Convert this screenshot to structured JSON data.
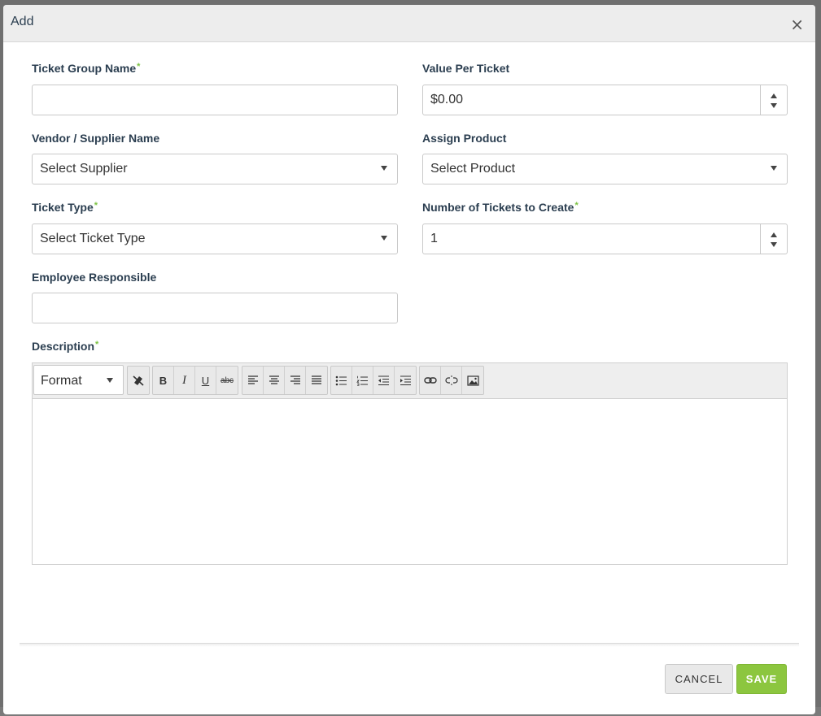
{
  "modal": {
    "title": "Add",
    "close_symbol": "×"
  },
  "fields": {
    "ticket_group_name": {
      "label": "Ticket Group Name",
      "required": "*",
      "value": ""
    },
    "value_per_ticket": {
      "label": "Value Per Ticket",
      "value": "$0.00"
    },
    "vendor_supplier": {
      "label": "Vendor / Supplier Name",
      "selected": "Select Supplier"
    },
    "assign_product": {
      "label": "Assign Product",
      "selected": "Select Product"
    },
    "ticket_type": {
      "label": "Ticket Type",
      "required": "*",
      "selected": "Select Ticket Type"
    },
    "number_of_tickets": {
      "label": "Number of Tickets to Create",
      "required": "*",
      "value": "1"
    },
    "employee_responsible": {
      "label": "Employee Responsible",
      "value": ""
    },
    "description": {
      "label": "Description",
      "required": "*"
    }
  },
  "editor": {
    "format_label": "Format",
    "buttons": {
      "bold": "B",
      "italic": "I",
      "underline": "U",
      "strikethrough": "abc"
    },
    "icons": [
      "remove-format-icon",
      "bold-icon",
      "italic-icon",
      "underline-icon",
      "strikethrough-icon",
      "align-left-icon",
      "align-center-icon",
      "align-right-icon",
      "align-justify-icon",
      "bulleted-list-icon",
      "numbered-list-icon",
      "outdent-icon",
      "indent-icon",
      "link-icon",
      "unlink-icon",
      "image-icon"
    ]
  },
  "footer": {
    "cancel_label": "CANCEL",
    "save_label": "SAVE"
  },
  "colors": {
    "accent": "#8cc63f",
    "label_text": "#2b3e50",
    "required_marker": "#7cc242"
  }
}
